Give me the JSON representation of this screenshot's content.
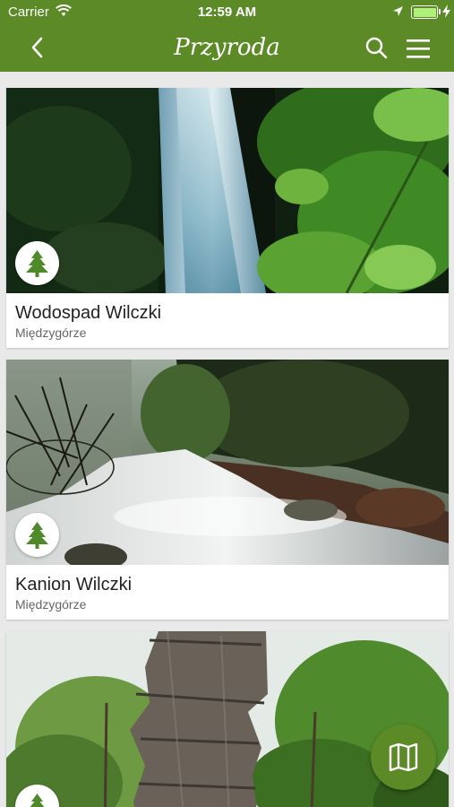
{
  "status_bar": {
    "carrier": "Carrier",
    "time": "12:59 AM",
    "battery_level": 1.0,
    "icons": [
      "wifi-icon",
      "location-arrow-icon",
      "battery-icon",
      "charging-bolt-icon"
    ]
  },
  "nav": {
    "title": "Przyroda",
    "icons": [
      "back-chevron-icon",
      "search-icon",
      "hamburger-menu-icon"
    ]
  },
  "places": [
    {
      "name": "Wodospad Wilczki",
      "location": "Międzygórze",
      "category_icon": "tree-icon"
    },
    {
      "name": "Kanion Wilczki",
      "location": "Międzygórze",
      "category_icon": "tree-icon"
    },
    {
      "name": "",
      "location": "",
      "category_icon": "tree-icon"
    }
  ],
  "fab": {
    "icon": "map-icon"
  },
  "colors": {
    "brand_green": "#5b8a26",
    "tree_green": "#4e8a2a",
    "background": "#e9e9e9",
    "battery_fill": "#aef07a"
  }
}
